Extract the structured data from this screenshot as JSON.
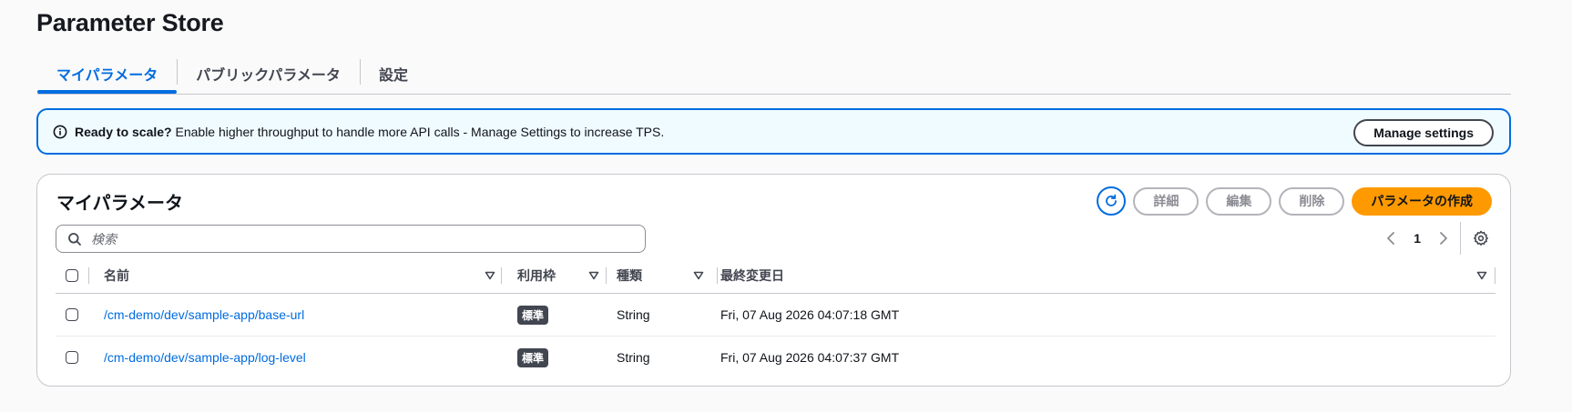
{
  "page": {
    "title": "Parameter Store"
  },
  "tabs": [
    {
      "label": "マイパラメータ",
      "active": true
    },
    {
      "label": "パブリックパラメータ",
      "active": false
    },
    {
      "label": "設定",
      "active": false
    }
  ],
  "banner": {
    "bold": "Ready to scale?",
    "text": " Enable higher throughput to handle more API calls - Manage Settings to increase TPS.",
    "button": "Manage settings",
    "icon": "info-icon"
  },
  "container": {
    "title": "マイパラメータ",
    "actions": {
      "refresh_icon": "refresh-icon",
      "details": "詳細",
      "edit": "編集",
      "delete": "削除",
      "create": "パラメータの作成"
    },
    "search": {
      "placeholder": "検索",
      "value": ""
    },
    "pagination": {
      "current_page": "1"
    }
  },
  "table": {
    "columns": [
      "名前",
      "利用枠",
      "種類",
      "最終変更日"
    ],
    "rows": [
      {
        "name": "/cm-demo/dev/sample-app/base-url",
        "tier": "標準",
        "type": "String",
        "modified": "Fri, 07 Aug 2026 04:07:18 GMT"
      },
      {
        "name": "/cm-demo/dev/sample-app/log-level",
        "tier": "標準",
        "type": "String",
        "modified": "Fri, 07 Aug 2026 04:07:37 GMT"
      }
    ]
  },
  "colors": {
    "accent": "#006ce0",
    "primary_button": "#ff9900",
    "banner_bg": "#f0fbff",
    "badge_bg": "#424650"
  }
}
